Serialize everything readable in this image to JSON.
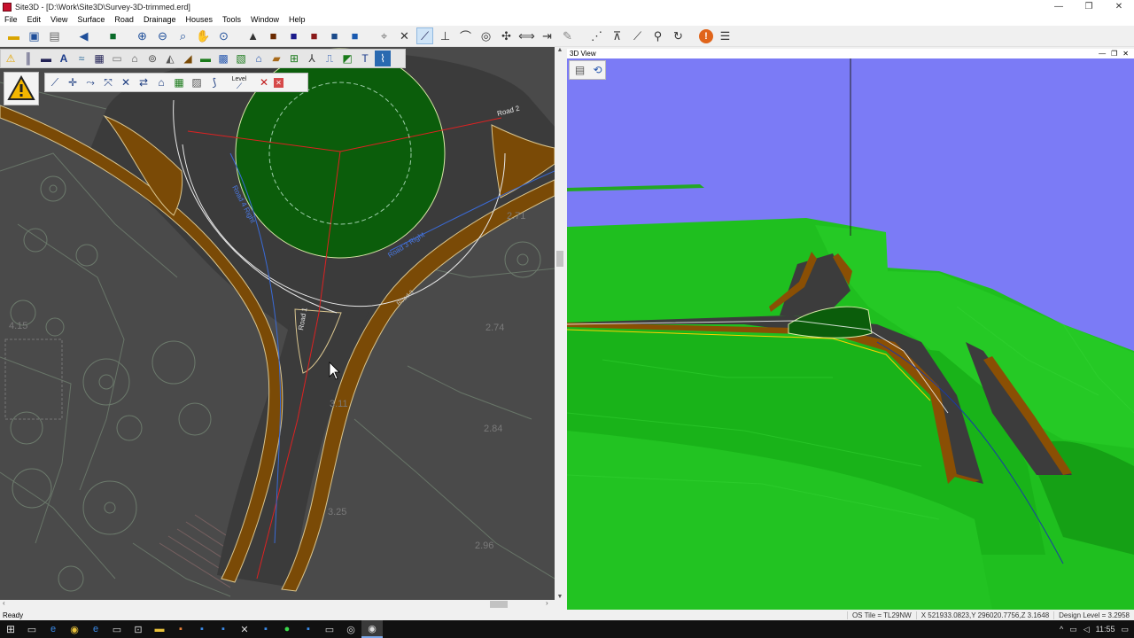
{
  "window": {
    "title": "Site3D - [D:\\Work\\Site3D\\Survey-3D-trimmed.erd]"
  },
  "menu": [
    "File",
    "Edit",
    "View",
    "Surface",
    "Road",
    "Drainage",
    "Houses",
    "Tools",
    "Window",
    "Help"
  ],
  "toolbar3": {
    "level_label": "Level"
  },
  "plan_labels": {
    "road2_label": "Road 2",
    "road1_label": "Road 1",
    "road4_label": "Road 4 Right",
    "road3_label": "Road 3 Right",
    "road_small_label": "Road 3",
    "spot_heights": [
      "2.71",
      "2.74",
      "4.15",
      "3.11",
      "2.84",
      "3.25",
      "2.96"
    ]
  },
  "view3d": {
    "title": "3D View"
  },
  "status": {
    "ready": "Ready",
    "os_tile": "OS Tile = TL29NW",
    "coords": "X 521933.0823,Y 296020.7756,Z 3.1648",
    "design_level": "Design Level = 3.2958"
  },
  "taskbar": {
    "clock": "11:55"
  },
  "icons": {
    "toolbar1": [
      "open-folder-icon",
      "save-icon",
      "print-icon",
      "back-icon",
      "layer-icon",
      "zoom-in-icon",
      "zoom-out-icon",
      "zoom-window-icon",
      "pan-icon",
      "zoom-extents-icon",
      "view-2d-icon",
      "view-3d-icon",
      "render-icon",
      "surface-icon",
      "grid-icon",
      "snap-icon",
      "trim-icon",
      "extend-icon",
      "line-icon",
      "arc-icon",
      "circle-icon",
      "move-icon",
      "stretch-icon",
      "measure-icon",
      "pencil-icon",
      "dimension-icon",
      "polyline-icon",
      "lasso-icon",
      "refresh-icon",
      "warning-icon",
      "list-icon"
    ],
    "toolbar2": [
      "warning-icon",
      "pole-icon",
      "kerb-icon",
      "text-a-icon",
      "hatch-icon",
      "table-icon",
      "drain-icon",
      "house-icon",
      "manhole-icon",
      "tunnel-icon",
      "ramp-icon",
      "bridge-icon",
      "section-icon",
      "pipe-icon",
      "tank-icon",
      "fence-icon",
      "sign-icon",
      "tree-icon",
      "profile-icon",
      "measure-icon",
      "text-icon",
      "chart-icon"
    ],
    "toolbar3": [
      "road-add-icon",
      "road-node-icon",
      "road-extend-icon",
      "road-align-icon",
      "road-cut-icon",
      "road-junction-icon",
      "road-surface-icon",
      "road-grid-icon",
      "road-hatch-icon",
      "road-curve-icon",
      "road-level-icon",
      "road-delete-icon",
      "close-icon"
    ],
    "view3d": [
      "print-icon",
      "rotate-icon"
    ],
    "taskbar": [
      "windows-start-icon",
      "task-view-icon",
      "edge-icon",
      "chrome-icon",
      "ie-icon",
      "mail-icon",
      "store-icon",
      "explorer-icon",
      "app-icon",
      "app-icon",
      "app-icon",
      "paint-icon",
      "app-icon",
      "app-icon",
      "app-icon",
      "app-icon",
      "app-icon",
      "site3d-icon"
    ]
  },
  "colors": {
    "road": "#7a4a06",
    "plan_bg": "#4a4a4a",
    "sky": "#7b7bf6",
    "grass": "#1fbf1f",
    "island": "#0b5d0b"
  }
}
